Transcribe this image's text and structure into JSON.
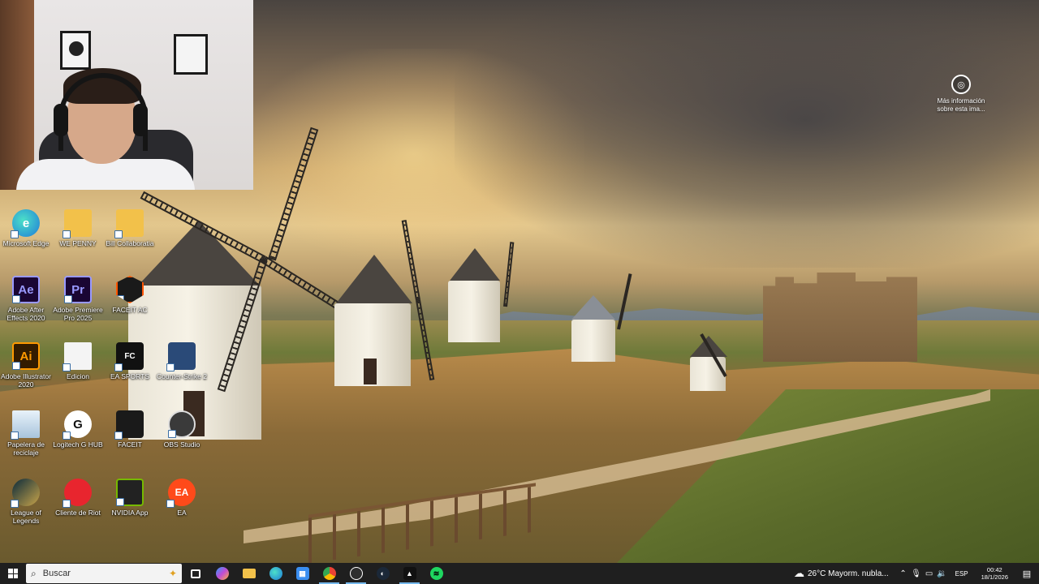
{
  "desktop": {
    "icons": [
      {
        "label": "Microsoft Edge",
        "glyph": "e",
        "icon": "edge-icon"
      },
      {
        "label": "WE PENNY",
        "glyph": "",
        "icon": "folder-icon"
      },
      {
        "label": "Bill Collaboratia",
        "glyph": "",
        "icon": "folder-icon"
      },
      {
        "label": "Adobe After Effects 2020",
        "glyph": "Ae",
        "icon": "after-effects-icon"
      },
      {
        "label": "Adobe Premiere Pro 2025",
        "glyph": "Pr",
        "icon": "premiere-icon"
      },
      {
        "label": "FACEIT AC",
        "glyph": "",
        "icon": "faceit-ac-icon"
      },
      {
        "label": "Adobe Illustrator 2020",
        "glyph": "Ai",
        "icon": "illustrator-icon"
      },
      {
        "label": "Edicion",
        "glyph": "",
        "icon": "document-icon"
      },
      {
        "label": "EA SPORTS",
        "glyph": "FC",
        "icon": "ea-sports-icon"
      },
      {
        "label": "Counter-Strike 2",
        "glyph": "",
        "icon": "counter-strike-icon"
      },
      {
        "label": "Papelera de reciclaje",
        "glyph": "",
        "icon": "recycle-bin-icon"
      },
      {
        "label": "Logitech G HUB",
        "glyph": "G",
        "icon": "logitech-icon"
      },
      {
        "label": "FACEIT",
        "glyph": "",
        "icon": "faceit-icon"
      },
      {
        "label": "OBS Studio",
        "glyph": "",
        "icon": "obs-icon"
      },
      {
        "label": "League of Legends",
        "glyph": "",
        "icon": "league-icon"
      },
      {
        "label": "Cliente de Riot",
        "glyph": "",
        "icon": "riot-icon"
      },
      {
        "label": "NVIDIA App",
        "glyph": "",
        "icon": "nvidia-icon"
      },
      {
        "label": "EA",
        "glyph": "EA",
        "icon": "ea-icon"
      }
    ],
    "info_label": "Más información sobre esta ima..."
  },
  "taskbar": {
    "search_placeholder": "Buscar",
    "weather_text": "26°C  Mayorm. nubla...",
    "lang": "ESP",
    "time": "00:42",
    "date": "18/1/2026"
  },
  "colors": {
    "taskbar_bg": "#1f1f1f",
    "accent": "#76b9ed"
  }
}
